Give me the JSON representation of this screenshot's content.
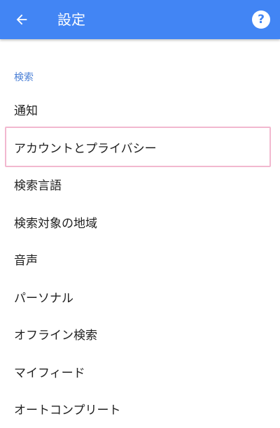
{
  "app_bar": {
    "title": "設定",
    "back_icon": "arrow-back-icon",
    "help_icon": "help-icon",
    "help_glyph": "?",
    "color": "#4285f4"
  },
  "section": {
    "header": "検索"
  },
  "items": [
    {
      "label": "通知"
    },
    {
      "label": "アカウントとプライバシー",
      "highlighted": true
    },
    {
      "label": "検索言語"
    },
    {
      "label": "検索対象の地域"
    },
    {
      "label": "音声"
    },
    {
      "label": "パーソナル"
    },
    {
      "label": "オフライン検索"
    },
    {
      "label": "マイフィード"
    },
    {
      "label": "オートコンプリート"
    }
  ]
}
